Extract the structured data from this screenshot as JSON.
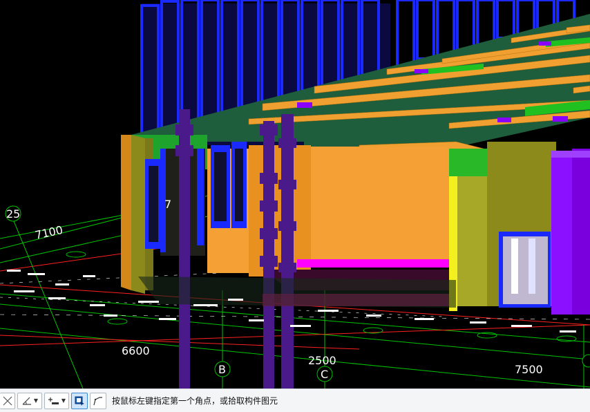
{
  "viewport": {
    "dimensions": [
      {
        "id": "dim-7100",
        "text": "7100"
      },
      {
        "id": "dim-6600",
        "text": "6600"
      },
      {
        "id": "dim-2500",
        "text": "2500"
      },
      {
        "id": "dim-7500",
        "text": "7500"
      },
      {
        "id": "dim-7-partial",
        "text": "7"
      }
    ],
    "axis_labels": {
      "axis_25": "25",
      "axis_b": "B",
      "axis_c": "C"
    }
  },
  "statusbar": {
    "message": "按鼠标左键指定第一个角点，或拾取构件图元",
    "icons": [
      "close-icon",
      "angle-icon",
      "snap-point-icon",
      "select-box-icon",
      "polyline-icon"
    ]
  },
  "colors": {
    "background": "#000000",
    "slab": "#1e5e3c",
    "beam": "#f0a030",
    "wall": "#f4a034",
    "wall_side": "#8c8a1a",
    "column": "#4a1a8a",
    "window": "#1a2aff",
    "grid_green": "#00c400",
    "grid_red": "#ff2020",
    "magenta_strip": "#ff00ff"
  }
}
